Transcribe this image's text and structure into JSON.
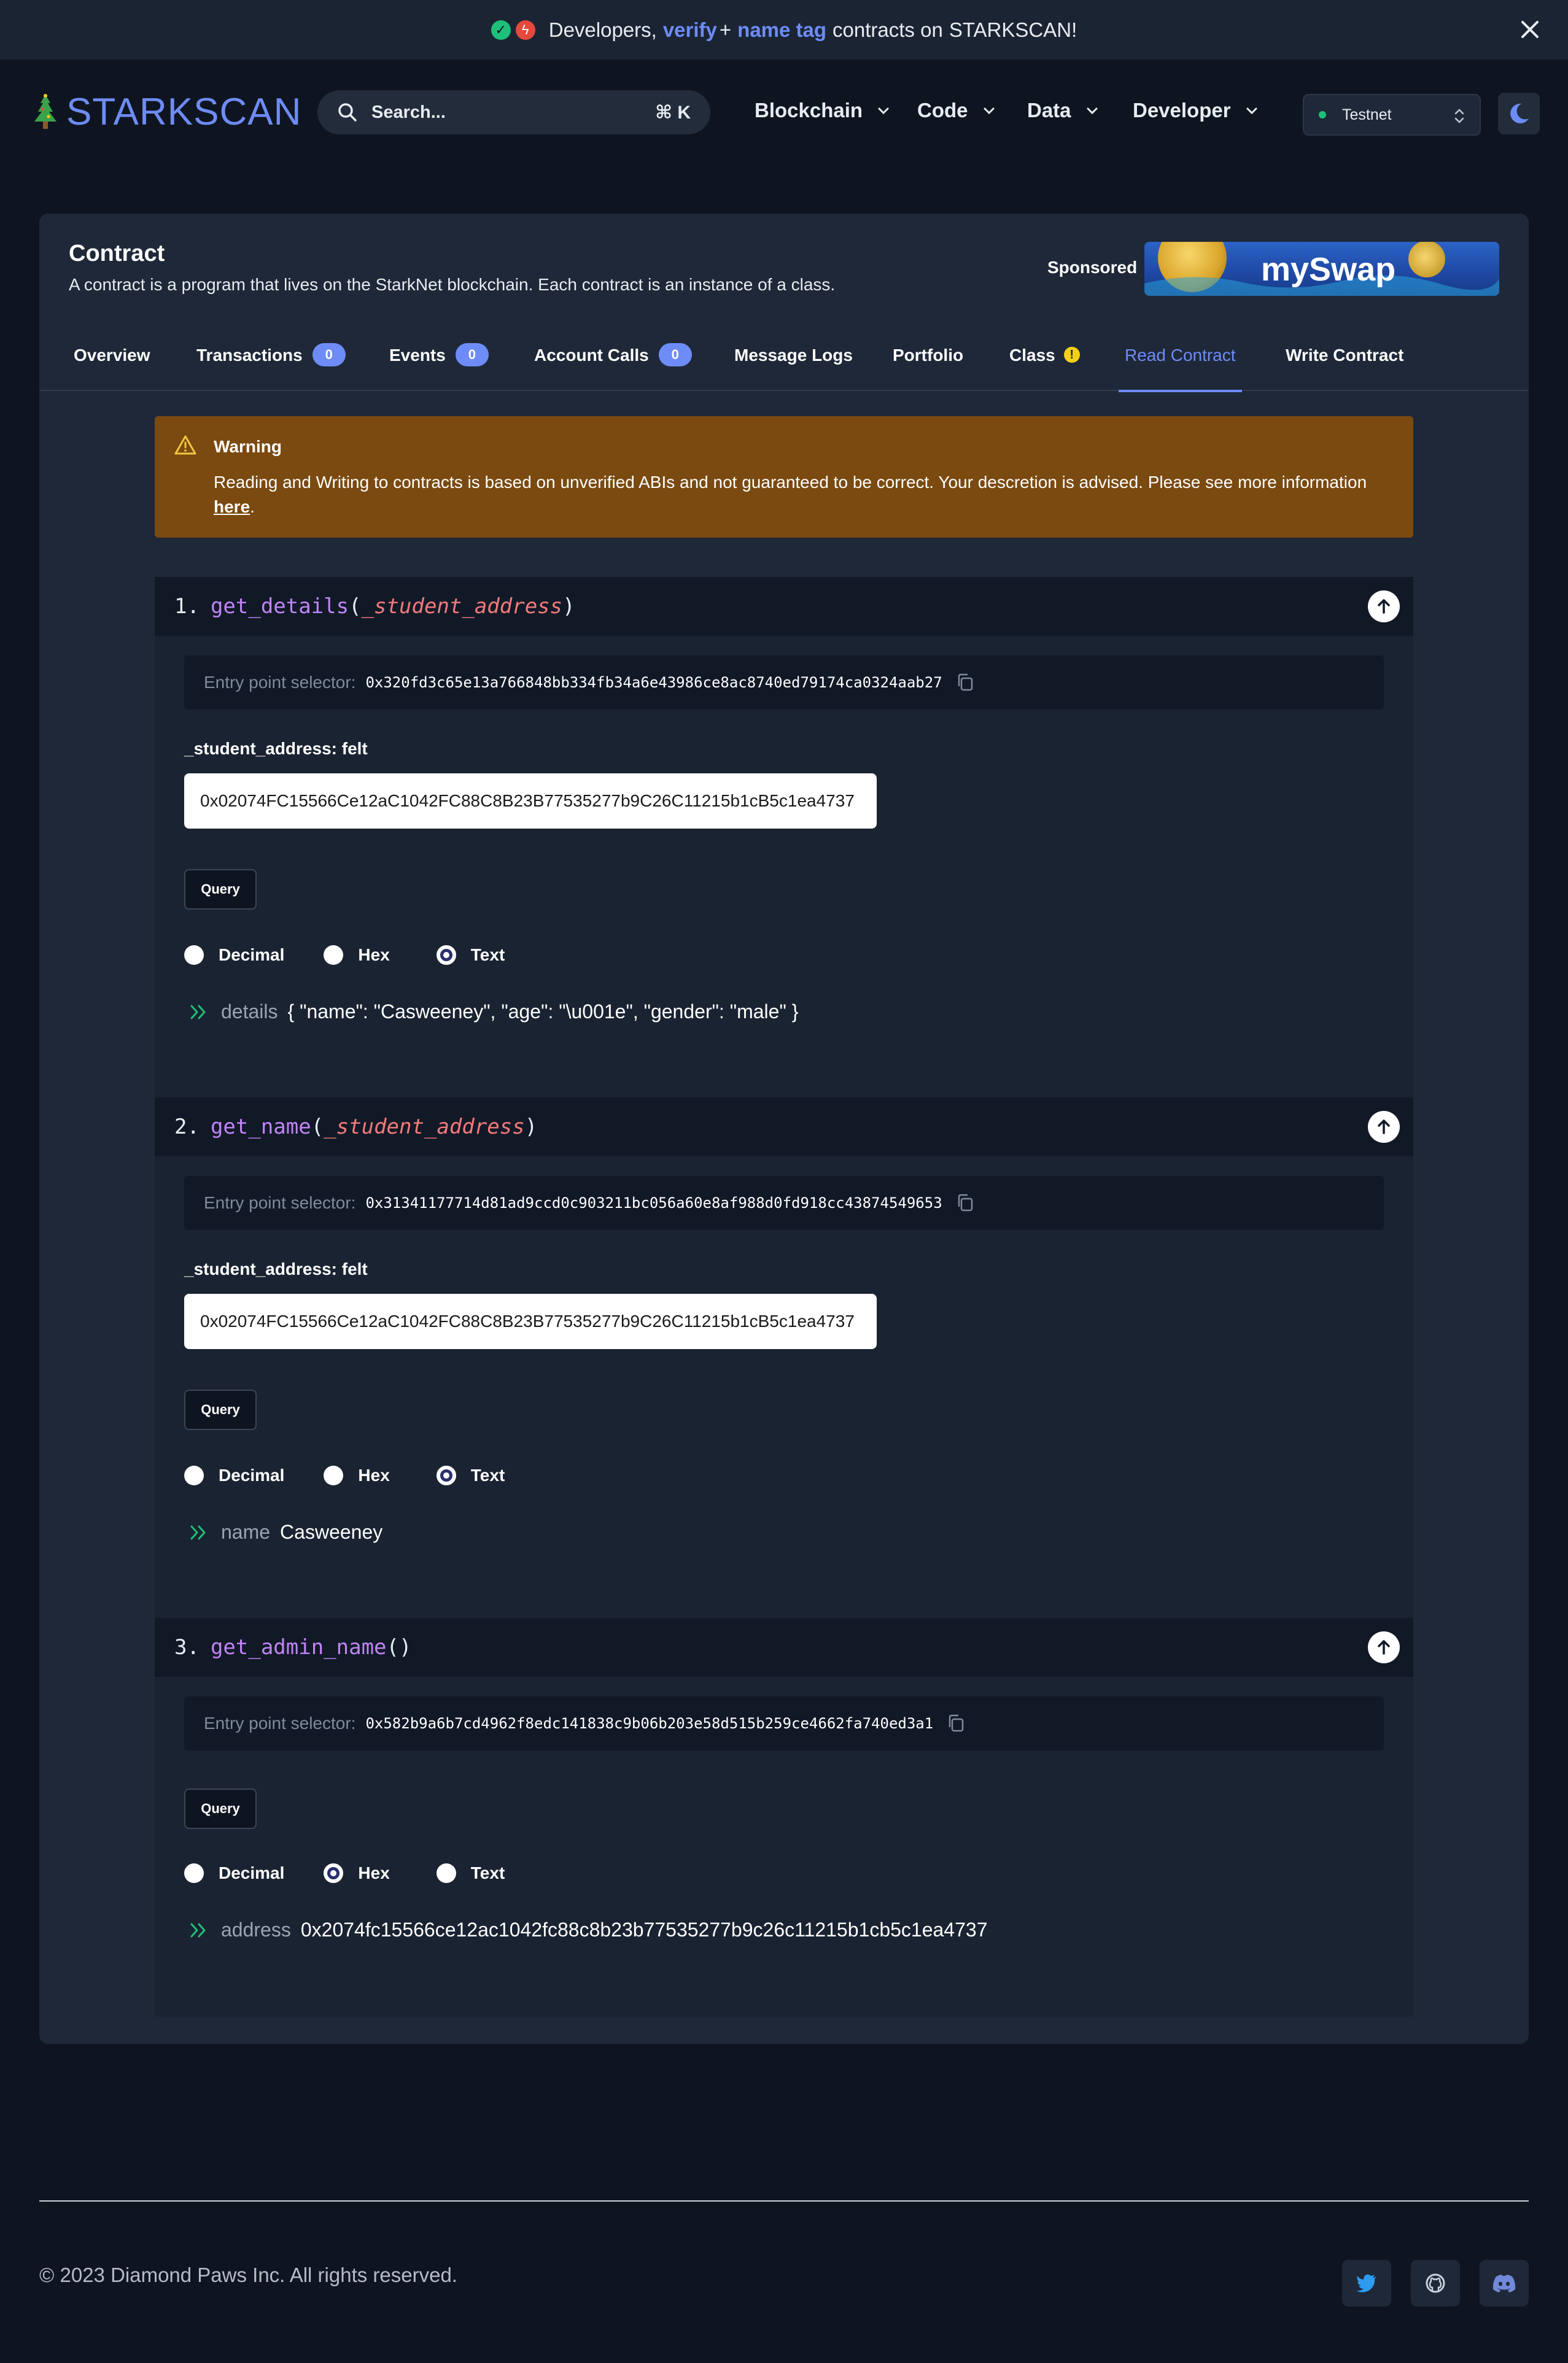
{
  "banner": {
    "part1": "Developers,",
    "verify": "verify",
    "plus": "+",
    "name_tag": "name tag",
    "part2": "contracts on",
    "brand": "STARKSCAN!"
  },
  "nav": {
    "brand": "STARKSCAN",
    "search_placeholder": "Search...",
    "search_shortcut": "⌘ K",
    "menus": [
      "Blockchain",
      "Code",
      "Data",
      "Developer"
    ],
    "network": "Testnet"
  },
  "card": {
    "title": "Contract",
    "subtitle": "A contract is a program that lives on the StarkNet blockchain. Each contract is an instance of a class.",
    "sponsored": "Sponsored",
    "ad_text": "mySwap"
  },
  "tabs": [
    {
      "label": "Overview",
      "badge": null
    },
    {
      "label": "Transactions",
      "badge": "0"
    },
    {
      "label": "Events",
      "badge": "0"
    },
    {
      "label": "Account Calls",
      "badge": "0"
    },
    {
      "label": "Message Logs",
      "badge": null
    },
    {
      "label": "Portfolio",
      "badge": null
    },
    {
      "label": "Class",
      "badge": "!"
    },
    {
      "label": "Read Contract",
      "badge": null
    },
    {
      "label": "Write Contract",
      "badge": null
    }
  ],
  "warning": {
    "title": "Warning",
    "text": "Reading and Writing to contracts is based on unverified ABIs and not guaranteed to be correct. Your descretion is advised. Please see more information",
    "link": "here",
    "end": "."
  },
  "functions": [
    {
      "number": "1.",
      "name": "get_details",
      "arg": "_student_address",
      "selector_label": "Entry point selector:",
      "selector": "0x320fd3c65e13a766848bb334fb34a6e43986ce8ac8740ed79174ca0324aab27",
      "input_label": "_student_address: felt",
      "input_value": "0x02074FC15566Ce12aC1042FC88C8B23B77535277b9C26C11215b1cB5c1ea4737",
      "query": "Query",
      "formats": [
        "Decimal",
        "Hex",
        "Text"
      ],
      "result_key": "details",
      "result_value": "{ \"name\": \"Casweeney\", \"age\": \"\\u001e\", \"gender\": \"male\" }"
    },
    {
      "number": "2.",
      "name": "get_name",
      "arg": "_student_address",
      "selector_label": "Entry point selector:",
      "selector": "0x31341177714d81ad9ccd0c903211bc056a60e8af988d0fd918cc43874549653",
      "input_label": "_student_address: felt",
      "input_value": "0x02074FC15566Ce12aC1042FC88C8B23B77535277b9C26C11215b1cB5c1ea4737",
      "query": "Query",
      "formats": [
        "Decimal",
        "Hex",
        "Text"
      ],
      "result_key": "name",
      "result_value": "Casweeney"
    },
    {
      "number": "3.",
      "name": "get_admin_name",
      "arg": "",
      "selector_label": "Entry point selector:",
      "selector": "0x582b9a6b7cd4962f8edc141838c9b06b203e58d515b259ce4662fa740ed3a1",
      "query": "Query",
      "formats": [
        "Decimal",
        "Hex",
        "Text"
      ],
      "result_key": "address",
      "result_value": "0x2074fc15566ce12ac1042fc88c8b23b77535277b9c26c11215b1cb5c1ea4737"
    }
  ],
  "footer": {
    "copyright": "© 2023 Diamond Paws Inc. All rights reserved."
  },
  "colors": {
    "accent": "#6e8cf7",
    "background": "#0f1520",
    "card": "#1e2838",
    "warning": "#7a4a10",
    "function_name": "#c085f5",
    "argument": "#f27a7a"
  }
}
